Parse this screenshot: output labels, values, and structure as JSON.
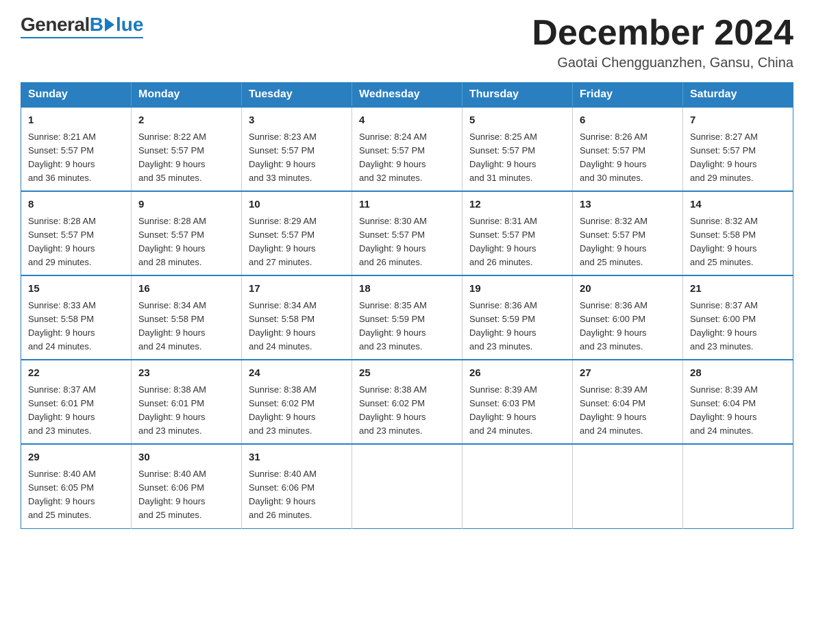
{
  "logo": {
    "general": "General",
    "blue": "Blue",
    "underline": "─────────"
  },
  "title": "December 2024",
  "location": "Gaotai Chengguanzhen, Gansu, China",
  "days_header": [
    "Sunday",
    "Monday",
    "Tuesday",
    "Wednesday",
    "Thursday",
    "Friday",
    "Saturday"
  ],
  "weeks": [
    [
      {
        "day": "1",
        "info": "Sunrise: 8:21 AM\nSunset: 5:57 PM\nDaylight: 9 hours\nand 36 minutes."
      },
      {
        "day": "2",
        "info": "Sunrise: 8:22 AM\nSunset: 5:57 PM\nDaylight: 9 hours\nand 35 minutes."
      },
      {
        "day": "3",
        "info": "Sunrise: 8:23 AM\nSunset: 5:57 PM\nDaylight: 9 hours\nand 33 minutes."
      },
      {
        "day": "4",
        "info": "Sunrise: 8:24 AM\nSunset: 5:57 PM\nDaylight: 9 hours\nand 32 minutes."
      },
      {
        "day": "5",
        "info": "Sunrise: 8:25 AM\nSunset: 5:57 PM\nDaylight: 9 hours\nand 31 minutes."
      },
      {
        "day": "6",
        "info": "Sunrise: 8:26 AM\nSunset: 5:57 PM\nDaylight: 9 hours\nand 30 minutes."
      },
      {
        "day": "7",
        "info": "Sunrise: 8:27 AM\nSunset: 5:57 PM\nDaylight: 9 hours\nand 29 minutes."
      }
    ],
    [
      {
        "day": "8",
        "info": "Sunrise: 8:28 AM\nSunset: 5:57 PM\nDaylight: 9 hours\nand 29 minutes."
      },
      {
        "day": "9",
        "info": "Sunrise: 8:28 AM\nSunset: 5:57 PM\nDaylight: 9 hours\nand 28 minutes."
      },
      {
        "day": "10",
        "info": "Sunrise: 8:29 AM\nSunset: 5:57 PM\nDaylight: 9 hours\nand 27 minutes."
      },
      {
        "day": "11",
        "info": "Sunrise: 8:30 AM\nSunset: 5:57 PM\nDaylight: 9 hours\nand 26 minutes."
      },
      {
        "day": "12",
        "info": "Sunrise: 8:31 AM\nSunset: 5:57 PM\nDaylight: 9 hours\nand 26 minutes."
      },
      {
        "day": "13",
        "info": "Sunrise: 8:32 AM\nSunset: 5:57 PM\nDaylight: 9 hours\nand 25 minutes."
      },
      {
        "day": "14",
        "info": "Sunrise: 8:32 AM\nSunset: 5:58 PM\nDaylight: 9 hours\nand 25 minutes."
      }
    ],
    [
      {
        "day": "15",
        "info": "Sunrise: 8:33 AM\nSunset: 5:58 PM\nDaylight: 9 hours\nand 24 minutes."
      },
      {
        "day": "16",
        "info": "Sunrise: 8:34 AM\nSunset: 5:58 PM\nDaylight: 9 hours\nand 24 minutes."
      },
      {
        "day": "17",
        "info": "Sunrise: 8:34 AM\nSunset: 5:58 PM\nDaylight: 9 hours\nand 24 minutes."
      },
      {
        "day": "18",
        "info": "Sunrise: 8:35 AM\nSunset: 5:59 PM\nDaylight: 9 hours\nand 23 minutes."
      },
      {
        "day": "19",
        "info": "Sunrise: 8:36 AM\nSunset: 5:59 PM\nDaylight: 9 hours\nand 23 minutes."
      },
      {
        "day": "20",
        "info": "Sunrise: 8:36 AM\nSunset: 6:00 PM\nDaylight: 9 hours\nand 23 minutes."
      },
      {
        "day": "21",
        "info": "Sunrise: 8:37 AM\nSunset: 6:00 PM\nDaylight: 9 hours\nand 23 minutes."
      }
    ],
    [
      {
        "day": "22",
        "info": "Sunrise: 8:37 AM\nSunset: 6:01 PM\nDaylight: 9 hours\nand 23 minutes."
      },
      {
        "day": "23",
        "info": "Sunrise: 8:38 AM\nSunset: 6:01 PM\nDaylight: 9 hours\nand 23 minutes."
      },
      {
        "day": "24",
        "info": "Sunrise: 8:38 AM\nSunset: 6:02 PM\nDaylight: 9 hours\nand 23 minutes."
      },
      {
        "day": "25",
        "info": "Sunrise: 8:38 AM\nSunset: 6:02 PM\nDaylight: 9 hours\nand 23 minutes."
      },
      {
        "day": "26",
        "info": "Sunrise: 8:39 AM\nSunset: 6:03 PM\nDaylight: 9 hours\nand 24 minutes."
      },
      {
        "day": "27",
        "info": "Sunrise: 8:39 AM\nSunset: 6:04 PM\nDaylight: 9 hours\nand 24 minutes."
      },
      {
        "day": "28",
        "info": "Sunrise: 8:39 AM\nSunset: 6:04 PM\nDaylight: 9 hours\nand 24 minutes."
      }
    ],
    [
      {
        "day": "29",
        "info": "Sunrise: 8:40 AM\nSunset: 6:05 PM\nDaylight: 9 hours\nand 25 minutes."
      },
      {
        "day": "30",
        "info": "Sunrise: 8:40 AM\nSunset: 6:06 PM\nDaylight: 9 hours\nand 25 minutes."
      },
      {
        "day": "31",
        "info": "Sunrise: 8:40 AM\nSunset: 6:06 PM\nDaylight: 9 hours\nand 26 minutes."
      },
      {
        "day": "",
        "info": ""
      },
      {
        "day": "",
        "info": ""
      },
      {
        "day": "",
        "info": ""
      },
      {
        "day": "",
        "info": ""
      }
    ]
  ]
}
